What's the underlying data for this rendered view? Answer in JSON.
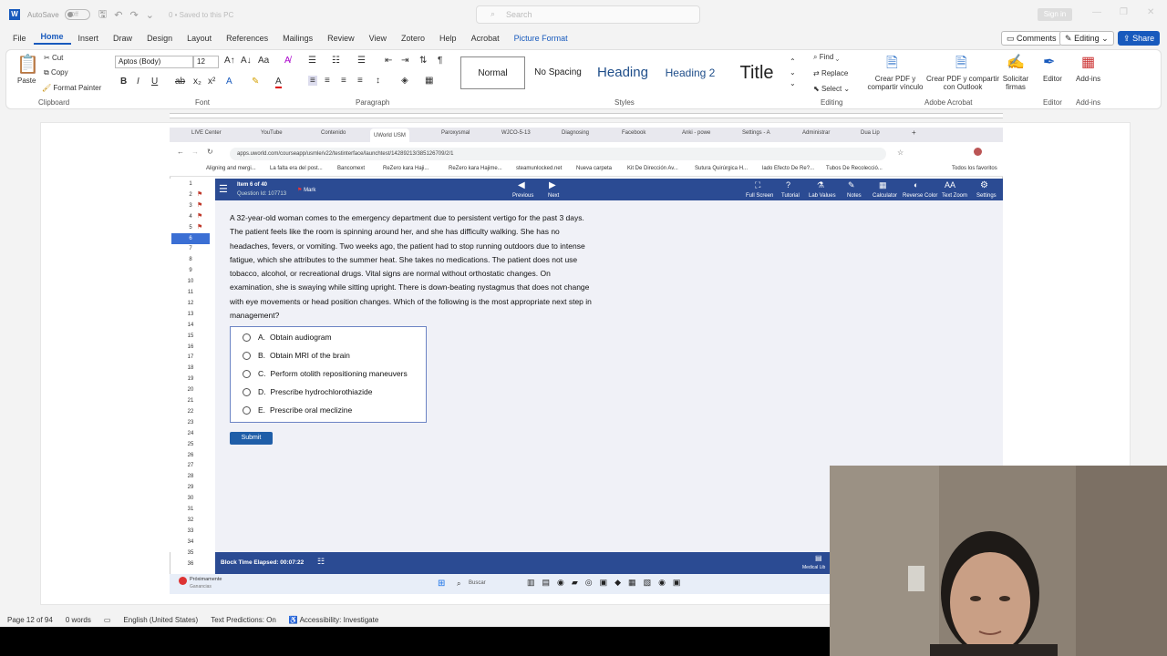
{
  "word": {
    "autosave_label": "AutoSave",
    "autosave_state": "Off",
    "save_status": "0 • Saved to this PC",
    "search_placeholder": "Search",
    "signin": "Sign in",
    "menus": [
      "File",
      "Home",
      "Insert",
      "Draw",
      "Design",
      "Layout",
      "References",
      "Mailings",
      "Review",
      "View",
      "Zotero",
      "Help",
      "Acrobat",
      "Picture Format"
    ],
    "comments": "Comments",
    "editing": "Editing",
    "share": "Share",
    "clipboard": {
      "paste": "Paste",
      "cut": "Cut",
      "copy": "Copy",
      "format_painter": "Format Painter",
      "label": "Clipboard"
    },
    "font": {
      "family": "Aptos (Body)",
      "size": "12",
      "label": "Font"
    },
    "paragraph_label": "Paragraph",
    "styles": {
      "items": [
        "Normal",
        "No Spacing",
        "Heading",
        "Heading 2",
        "Title"
      ],
      "label": "Styles"
    },
    "editing_group": {
      "find": "Find",
      "replace": "Replace",
      "select": "Select",
      "label": "Editing"
    },
    "acrobat": {
      "create_pdf_link": "Crear PDF y compartir vínculo",
      "create_pdf_outlook": "Crear PDF y compartir con Outlook",
      "request_sign": "Solicitar firmas",
      "label": "Adobe Acrobat"
    },
    "editor": "Editor",
    "addins": "Add-ins",
    "status": {
      "page": "Page 12 of 94",
      "words": "0 words",
      "language": "English (United States)",
      "predictions": "Text Predictions: On",
      "accessibility": "Accessibility: Investigate"
    }
  },
  "browser": {
    "tabs": [
      "LIVE Center",
      "YouTube",
      "Contenido",
      "UWorld USM",
      "Paroxysmal",
      "WJCO-5-13",
      "Diagnosing",
      "Facebook",
      "Anki - powe",
      "Settings - A",
      "Administrar",
      "Dua Lip"
    ],
    "url": "apps.uworld.com/courseapp/usmle/v22/testinterface/launchtest/14289213/385126709/2/1",
    "bookmarks": [
      "Aligning and mergi...",
      "La falta era del post...",
      "Bancomext",
      "ReZero kara Haji...",
      "ReZero kara Hajime...",
      "steamunlocked.net",
      "Nueva carpeta",
      "Kit De Dirección Av...",
      "Sutura Quirúrgica H...",
      "lado Efecto De Re?...",
      "Tubos De Recolecció...",
      "Todos los favoritos"
    ]
  },
  "uworld": {
    "item": "Item 6 of 40",
    "question_id": "Question Id: 107713",
    "mark": "Mark",
    "previous": "Previous",
    "next": "Next",
    "tools": [
      "Full Screen",
      "Tutorial",
      "Lab Values",
      "Notes",
      "Calculator",
      "Reverse Color",
      "Text Zoom",
      "Settings"
    ],
    "question_numbers": [
      "1",
      "2",
      "3",
      "4",
      "5",
      "6",
      "7",
      "8",
      "9",
      "10",
      "11",
      "12",
      "13",
      "14",
      "15",
      "16",
      "17",
      "18",
      "19",
      "20",
      "21",
      "22",
      "23",
      "24",
      "25",
      "26",
      "27",
      "28",
      "29",
      "30",
      "31",
      "32",
      "33",
      "34",
      "35",
      "36"
    ],
    "stem_lines": [
      "A 32-year-old woman comes to the emergency department due to persistent vertigo for the past 3 days.",
      "The patient feels like the room is spinning around her, and she has difficulty walking.  She has no",
      "headaches, fevers, or vomiting.  Two weeks ago, the patient had to stop running outdoors due to intense",
      "fatigue, which she attributes to the summer heat.  She takes no medications.  The patient does not use",
      "tobacco, alcohol, or recreational drugs.  Vital signs are normal without orthostatic changes.  On",
      "examination, she is swaying while sitting upright.  There is down-beating nystagmus that does not change",
      "with eye movements or head position changes.  Which of the following is the most appropriate next step in",
      "management?"
    ],
    "answers": [
      {
        "letter": "A.",
        "text": "Obtain audiogram"
      },
      {
        "letter": "B.",
        "text": "Obtain MRI of the brain"
      },
      {
        "letter": "C.",
        "text": "Perform otolith repositioning maneuvers"
      },
      {
        "letter": "D.",
        "text": "Prescribe hydrochlorothiazide"
      },
      {
        "letter": "E.",
        "text": "Prescribe oral meclizine"
      }
    ],
    "submit": "Submit",
    "timer": "Block Time Elapsed: 00:07:22",
    "medical_library": "Medical Lib",
    "taskbar_search": "Buscar",
    "weather_line1": "Próximamente",
    "weather_line2": "Ganancias"
  }
}
